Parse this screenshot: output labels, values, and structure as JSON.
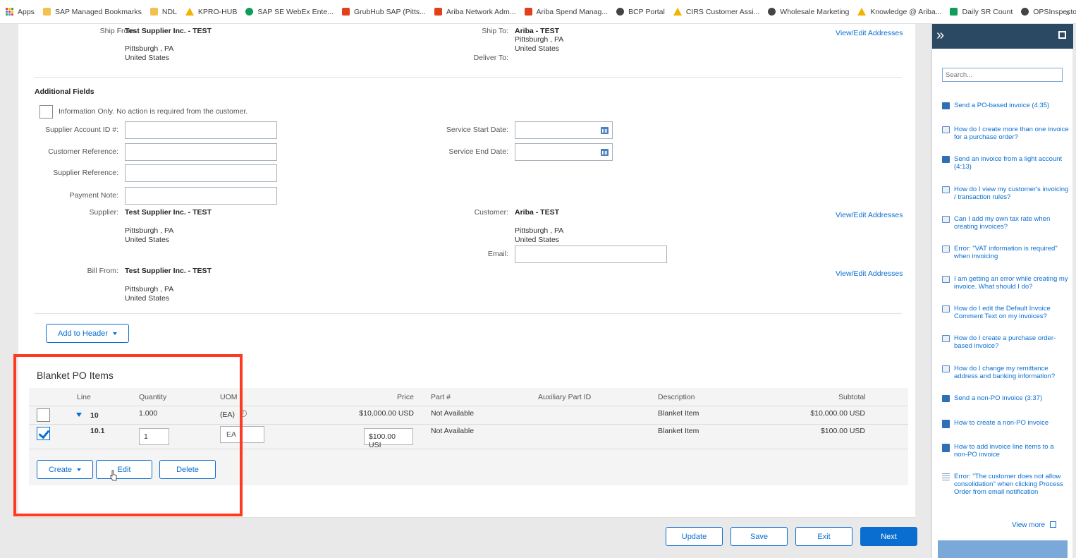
{
  "bookmarks": [
    {
      "label": "Apps",
      "icon": "apps-grid-icon"
    },
    {
      "label": "SAP Managed Bookmarks",
      "icon": "folder-icon"
    },
    {
      "label": "NDL",
      "icon": "folder-icon"
    },
    {
      "label": "KPRO-HUB",
      "icon": "warning-triangle-icon"
    },
    {
      "label": "SAP SE WebEx Ente...",
      "icon": "webex-icon"
    },
    {
      "label": "GrubHub SAP (Pitts...",
      "icon": "grubhub-icon"
    },
    {
      "label": "Ariba Network Adm...",
      "icon": "ariba-icon"
    },
    {
      "label": "Ariba Spend Manag...",
      "icon": "ariba-icon"
    },
    {
      "label": "BCP Portal",
      "icon": "globe-icon"
    },
    {
      "label": "CIRS Customer Assi...",
      "icon": "warning-triangle-icon"
    },
    {
      "label": "Wholesale Marketing",
      "icon": "cube-icon"
    },
    {
      "label": "Knowledge @ Ariba...",
      "icon": "warning-triangle-icon"
    },
    {
      "label": "Daily SR Count",
      "icon": "sheets-icon"
    },
    {
      "label": "OPSInspector",
      "icon": "globe-icon"
    }
  ],
  "bookmarks_more": "»",
  "ship": {
    "from_label": "Ship From:",
    "from_name": "Test Supplier Inc. - TEST",
    "from_city": "Pittsburgh , PA",
    "from_country": "United States",
    "to_label": "Ship To:",
    "to_name": "Ariba - TEST",
    "to_city": "Pittsburgh , PA",
    "to_country": "United States",
    "deliver_label": "Deliver To:",
    "view_edit": "View/Edit Addresses"
  },
  "additional": {
    "title": "Additional Fields",
    "info_only": "Information Only. No action is required from the customer.",
    "supplier_account_label": "Supplier Account ID #:",
    "customer_ref_label": "Customer Reference:",
    "supplier_ref_label": "Supplier Reference:",
    "payment_note_label": "Payment Note:",
    "service_start_label": "Service Start Date:",
    "service_end_label": "Service End Date:",
    "supplier_label": "Supplier:",
    "supplier_name": "Test Supplier Inc. - TEST",
    "supplier_city": "Pittsburgh , PA",
    "supplier_country": "United States",
    "customer_label": "Customer:",
    "customer_name": "Ariba - TEST",
    "customer_city": "Pittsburgh , PA",
    "customer_country": "United States",
    "email_label": "Email:",
    "bill_from_label": "Bill From:",
    "bill_from_name": "Test Supplier Inc. - TEST",
    "bill_from_city": "Pittsburgh , PA",
    "bill_from_country": "United States",
    "view_edit_1": "View/Edit Addresses",
    "view_edit_2": "View/Edit Addresses"
  },
  "add_to_header": "Add to Header",
  "items": {
    "title": "Blanket PO Items",
    "columns": {
      "line": "Line",
      "quantity": "Quantity",
      "uom": "UOM",
      "price": "Price",
      "part": "Part #",
      "aux": "Auxiliary Part ID",
      "description": "Description",
      "subtotal": "Subtotal"
    },
    "rows": [
      {
        "line": "10",
        "quantity": "1.000",
        "uom": "(EA)",
        "price": "$10,000.00 USD",
        "part": "Not Available",
        "description": "Blanket Item",
        "subtotal": "$10,000.00 USD",
        "checked": false
      },
      {
        "line": "10.1",
        "quantity": "1",
        "uom": "EA",
        "price": "$100.00 USI",
        "part": "Not Available",
        "description": "Blanket Item",
        "subtotal": "$100.00 USD",
        "checked": true
      }
    ],
    "create": "Create",
    "edit": "Edit",
    "delete": "Delete"
  },
  "footer": {
    "update": "Update",
    "save": "Save",
    "exit": "Exit",
    "next": "Next"
  },
  "sidebar": {
    "expand_icon": "double-chevron-right-icon",
    "popout_icon": "external-link-icon",
    "search_placeholder": "Search...",
    "items": [
      {
        "text": "Send a PO-based invoice (4:35)",
        "icon": "video-icon"
      },
      {
        "text": "How do I create more than one invoice for a purchase order?",
        "icon": "faq-icon"
      },
      {
        "text": "Send an invoice from a light account (4:13)",
        "icon": "video-icon"
      },
      {
        "text": "How do I view my customer's invoicing / transaction rules?",
        "icon": "faq-icon"
      },
      {
        "text": "Can I add my own tax rate when creating invoices?",
        "icon": "faq-icon"
      },
      {
        "text": "Error: \"VAT information is required\" when invoicing",
        "icon": "faq-icon"
      },
      {
        "text": "I am getting an error while creating my invoice. What should I do?",
        "icon": "faq-icon"
      },
      {
        "text": "How do I edit the Default Invoice Comment Text on my invoices?",
        "icon": "faq-icon"
      },
      {
        "text": "How do I create a purchase order-based invoice?",
        "icon": "faq-icon"
      },
      {
        "text": "How do I change my remittance address and banking information?",
        "icon": "faq-icon"
      },
      {
        "text": "Send a non-PO invoice (3:37)",
        "icon": "video-icon"
      },
      {
        "text": "How to create a non-PO invoice",
        "icon": "document-icon"
      },
      {
        "text": "How to add invoice line items to a non-PO invoice",
        "icon": "document-icon"
      },
      {
        "text": "Error: \"The customer does not allow consolidation\" when clicking Process Order from email notification",
        "icon": "list-icon"
      }
    ],
    "view_more": "View more"
  }
}
